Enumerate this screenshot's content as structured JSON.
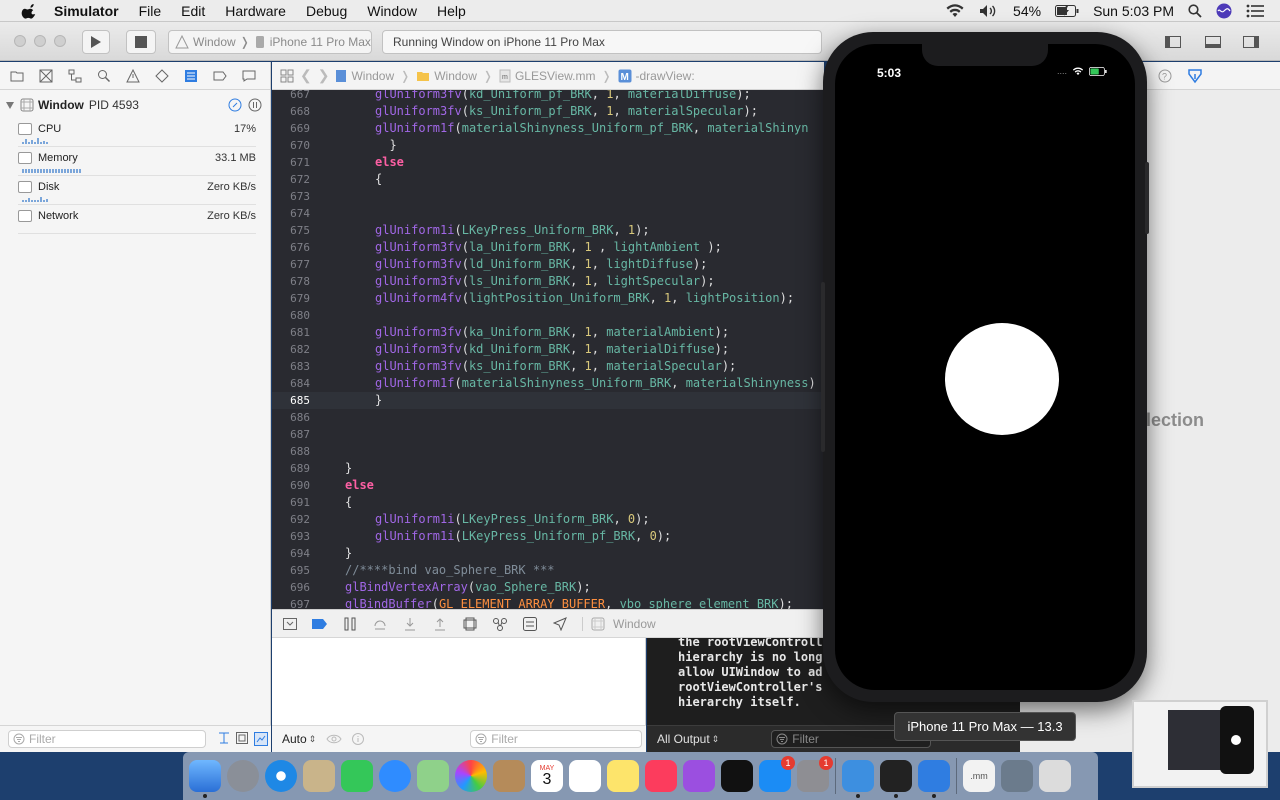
{
  "menubar": {
    "app_name": "Simulator",
    "menus": [
      "File",
      "Edit",
      "Hardware",
      "Debug",
      "Window",
      "Help"
    ],
    "battery": "54%",
    "clock": "Sun 5:03 PM"
  },
  "toolbar": {
    "scheme": "Window",
    "destination": "iPhone 11 Pro Max",
    "activity": "Running Window on iPhone 11 Pro Max"
  },
  "navigator": {
    "process_name": "Window",
    "process_pid": "PID 4593",
    "gauges": [
      {
        "label": "CPU",
        "value": "17%"
      },
      {
        "label": "Memory",
        "value": "33.1 MB"
      },
      {
        "label": "Disk",
        "value": "Zero KB/s"
      },
      {
        "label": "Network",
        "value": "Zero KB/s"
      }
    ],
    "filter_placeholder": "Filter"
  },
  "jumpbar": {
    "crumbs": [
      "Window",
      "Window",
      "GLESView.mm",
      "-drawView:"
    ]
  },
  "editor": {
    "current_line": "685",
    "lines": [
      {
        "n": "667",
        "t": "glUniform3fv(kd_Uniform_pf_BRK, 1, materialDiffuse);"
      },
      {
        "n": "668",
        "t": "glUniform3fv(ks_Uniform_pf_BRK, 1, materialSpecular);"
      },
      {
        "n": "669",
        "t": "glUniform1f(materialShinyness_Uniform_pf_BRK, materialShinyn"
      },
      {
        "n": "670",
        "t": "  }"
      },
      {
        "n": "671",
        "t": "else"
      },
      {
        "n": "672",
        "t": "{"
      },
      {
        "n": "673",
        "t": ""
      },
      {
        "n": "674",
        "t": ""
      },
      {
        "n": "675",
        "t": "glUniform1i(LKeyPress_Uniform_BRK, 1);"
      },
      {
        "n": "676",
        "t": "glUniform3fv(la_Uniform_BRK, 1 , lightAmbient );"
      },
      {
        "n": "677",
        "t": "glUniform3fv(ld_Uniform_BRK, 1, lightDiffuse);"
      },
      {
        "n": "678",
        "t": "glUniform3fv(ls_Uniform_BRK, 1, lightSpecular);"
      },
      {
        "n": "679",
        "t": "glUniform4fv(lightPosition_Uniform_BRK, 1, lightPosition);"
      },
      {
        "n": "680",
        "t": ""
      },
      {
        "n": "681",
        "t": "glUniform3fv(ka_Uniform_BRK, 1, materialAmbient);"
      },
      {
        "n": "682",
        "t": "glUniform3fv(kd_Uniform_BRK, 1, materialDiffuse);"
      },
      {
        "n": "683",
        "t": "glUniform3fv(ks_Uniform_BRK, 1, materialSpecular);"
      },
      {
        "n": "684",
        "t": "glUniform1f(materialShinyness_Uniform_BRK, materialShinyness)"
      },
      {
        "n": "685",
        "t": "}"
      },
      {
        "n": "686",
        "t": ""
      },
      {
        "n": "687",
        "t": ""
      },
      {
        "n": "688",
        "t": ""
      },
      {
        "n": "689",
        "t": "}"
      },
      {
        "n": "690",
        "t": "else"
      },
      {
        "n": "691",
        "t": "{"
      },
      {
        "n": "692",
        "t": "glUniform1i(LKeyPress_Uniform_BRK, 0);"
      },
      {
        "n": "693",
        "t": "glUniform1i(LKeyPress_Uniform_pf_BRK, 0);"
      },
      {
        "n": "694",
        "t": "}"
      },
      {
        "n": "695",
        "t": "//****bind vao_Sphere_BRK ***"
      },
      {
        "n": "696",
        "t": "glBindVertexArray(vao_Sphere_BRK);"
      },
      {
        "n": "697",
        "t": "glBindBuffer(GL_ELEMENT_ARRAY_BUFFER, vbo_sphere_element_BRK);"
      }
    ]
  },
  "debugbar": {
    "process": "Window"
  },
  "debug_area": {
    "variables_scope": "Auto",
    "variables_filter": "Filter",
    "console_scope": "All Output",
    "console_filter": "Filter",
    "console_text": "the rootViewControll\nhierarchy is no long\nallow UIWindow to ad\nrootViewController's\nhierarchy itself."
  },
  "inspector": {
    "no_selection": "lection"
  },
  "simulator": {
    "status_time": "5:03",
    "tooltip": "iPhone 11 Pro Max — 13.3"
  },
  "dock": {
    "calendar_month": "MAY",
    "calendar_day": "3",
    "appstore_badge": "1",
    "prefs_badge": "1",
    "file_label": ".mm"
  }
}
